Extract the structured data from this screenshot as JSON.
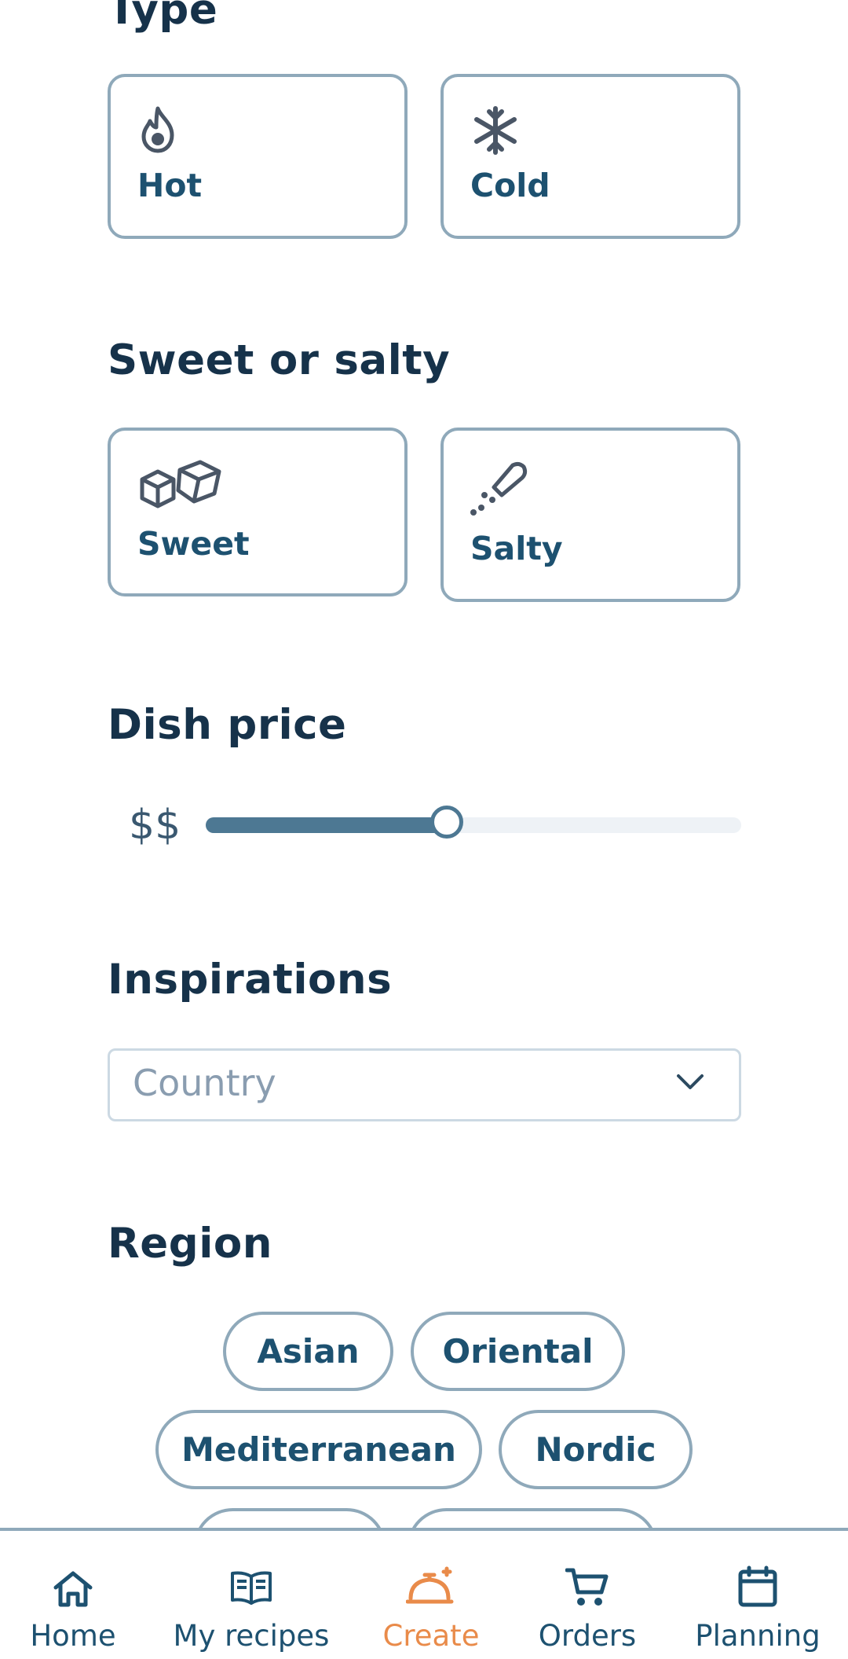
{
  "sections": {
    "type": {
      "title": "Type",
      "options": [
        {
          "label": "Hot",
          "icon": "flame-icon"
        },
        {
          "label": "Cold",
          "icon": "snowflake-icon"
        }
      ]
    },
    "sweet_salty": {
      "title": "Sweet or salty",
      "options": [
        {
          "label": "Sweet",
          "icon": "sugar-cubes-icon"
        },
        {
          "label": "Salty",
          "icon": "salt-shaker-icon"
        }
      ]
    },
    "price": {
      "title": "Dish price",
      "value_label": "$$",
      "level": 0.45
    },
    "inspirations": {
      "title": "Inspirations",
      "country_placeholder": "Country"
    },
    "region": {
      "title": "Region",
      "chips": [
        "Asian",
        "Oriental",
        "Mediterranean",
        "Nordic"
      ]
    }
  },
  "bottom_nav": {
    "items": [
      {
        "label": "Home",
        "icon": "home-icon"
      },
      {
        "label": "My recipes",
        "icon": "book-icon"
      },
      {
        "label": "Create",
        "icon": "cloche-icon",
        "active": true
      },
      {
        "label": "Orders",
        "icon": "cart-icon"
      },
      {
        "label": "Planning",
        "icon": "calendar-icon"
      }
    ]
  },
  "colors": {
    "accent": "#e98b4a",
    "primary": "#1d5170",
    "border": "#8fa9ba",
    "heading": "#16324a"
  }
}
